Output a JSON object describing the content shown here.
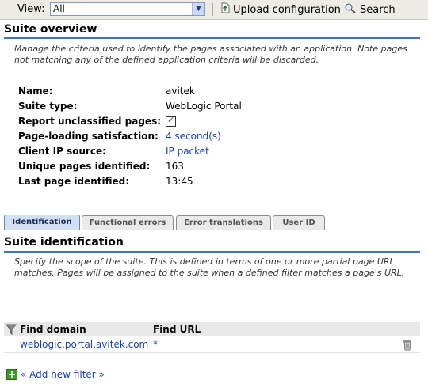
{
  "toolbar": {
    "view_label": "View:",
    "view_value": "All",
    "upload_label": "Upload configuration",
    "search_label": "Search"
  },
  "overview": {
    "title": "Suite overview",
    "description": "Manage the criteria used to identify the pages associated with an application. Note pages not matching any of the defined application criteria will be discarded.",
    "properties": [
      {
        "label": "Name:",
        "value": "avitek"
      },
      {
        "label": "Suite type:",
        "value": "WebLogic Portal"
      },
      {
        "label": "Report unclassified pages:",
        "value": ""
      },
      {
        "label": "Page-loading satisfaction:",
        "value": "4 second(s)"
      },
      {
        "label": "Client IP source:",
        "value": "IP packet"
      },
      {
        "label": "Unique pages identified:",
        "value": "163"
      },
      {
        "label": "Last page identified:",
        "value": "13:45"
      }
    ],
    "report_unclassified_checked": true
  },
  "tabs": [
    {
      "label": "Identification",
      "active": true
    },
    {
      "label": "Functional errors",
      "active": false
    },
    {
      "label": "Error translations",
      "active": false
    },
    {
      "label": "User ID",
      "active": false
    }
  ],
  "identification": {
    "title": "Suite identification",
    "description": "Specify the scope of the suite. This is defined in terms of one or more partial page URL matches. Pages will be assigned to the suite when a defined filter matches a page's URL.",
    "columns": [
      "Find domain",
      "Find URL"
    ],
    "rows": [
      {
        "domain": "weblogic.portal.avitek.com",
        "url": "*"
      }
    ],
    "add_filter_label": "« Add new filter »"
  }
}
